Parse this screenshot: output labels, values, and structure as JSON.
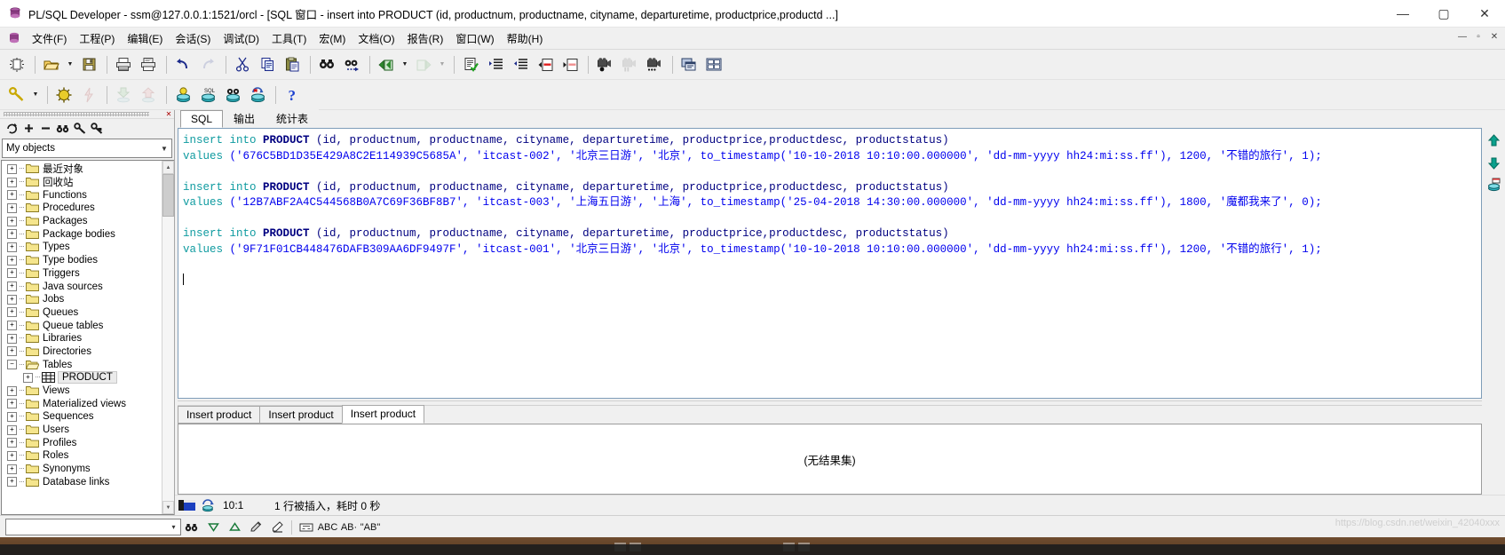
{
  "window": {
    "title": "PL/SQL Developer - ssm@127.0.0.1:1521/orcl - [SQL 窗口 - insert into PRODUCT (id, productnum, productname, cityname, departuretime, productprice,productd ...]",
    "app_icon": "plsql-developer-icon",
    "minimize": "—",
    "maximize": "▢",
    "close": "✕"
  },
  "menu": {
    "mdi_icon": "mdi-document-icon",
    "items": [
      {
        "label": "文件(F)",
        "name": "menu-file"
      },
      {
        "label": "工程(P)",
        "name": "menu-project"
      },
      {
        "label": "编辑(E)",
        "name": "menu-edit"
      },
      {
        "label": "会话(S)",
        "name": "menu-session"
      },
      {
        "label": "调试(D)",
        "name": "menu-debug"
      },
      {
        "label": "工具(T)",
        "name": "menu-tools"
      },
      {
        "label": "宏(M)",
        "name": "menu-macro"
      },
      {
        "label": "文档(O)",
        "name": "menu-document"
      },
      {
        "label": "报告(R)",
        "name": "menu-report"
      },
      {
        "label": "窗口(W)",
        "name": "menu-window"
      },
      {
        "label": "帮助(H)",
        "name": "menu-help"
      }
    ],
    "mdi_buttons": [
      "—",
      "▫",
      "✕"
    ]
  },
  "toolbar_row1": [
    {
      "name": "new-window-icon",
      "kind": "icon"
    },
    {
      "name": "toolbar-separator",
      "kind": "sep"
    },
    {
      "name": "open-file-icon",
      "kind": "icon"
    },
    {
      "name": "open-file-dropdown-icon",
      "kind": "arrow"
    },
    {
      "name": "save-icon",
      "kind": "icon"
    },
    {
      "name": "toolbar-separator",
      "kind": "sep"
    },
    {
      "name": "print-icon",
      "kind": "icon"
    },
    {
      "name": "print-preview-icon",
      "kind": "icon"
    },
    {
      "name": "toolbar-separator",
      "kind": "sep"
    },
    {
      "name": "undo-icon",
      "kind": "icon"
    },
    {
      "name": "redo-icon",
      "kind": "icon"
    },
    {
      "name": "toolbar-separator",
      "kind": "sep"
    },
    {
      "name": "cut-icon",
      "kind": "icon"
    },
    {
      "name": "copy-icon",
      "kind": "icon"
    },
    {
      "name": "paste-icon",
      "kind": "icon"
    },
    {
      "name": "toolbar-separator",
      "kind": "sep"
    },
    {
      "name": "find-icon",
      "kind": "icon"
    },
    {
      "name": "find-next-icon",
      "kind": "icon"
    },
    {
      "name": "toolbar-separator",
      "kind": "sep"
    },
    {
      "name": "previous-window-icon",
      "kind": "icon"
    },
    {
      "name": "previous-window-dropdown-icon",
      "kind": "arrow"
    },
    {
      "name": "next-window-icon",
      "kind": "icon"
    },
    {
      "name": "next-window-dropdown-icon",
      "kind": "arrow"
    },
    {
      "name": "toolbar-separator",
      "kind": "sep"
    },
    {
      "name": "check-syntax-icon",
      "kind": "icon"
    },
    {
      "name": "indent-icon",
      "kind": "icon"
    },
    {
      "name": "outdent-icon",
      "kind": "icon"
    },
    {
      "name": "comment-icon",
      "kind": "icon"
    },
    {
      "name": "uncomment-icon",
      "kind": "icon"
    },
    {
      "name": "toolbar-separator",
      "kind": "sep"
    },
    {
      "name": "record-macro-icon",
      "kind": "icon"
    },
    {
      "name": "pause-macro-icon",
      "kind": "icon"
    },
    {
      "name": "play-macro-icon",
      "kind": "icon"
    },
    {
      "name": "toolbar-separator",
      "kind": "sep"
    },
    {
      "name": "window-list-icon",
      "kind": "icon"
    },
    {
      "name": "tile-windows-icon",
      "kind": "icon"
    }
  ],
  "toolbar_row2": [
    {
      "name": "logon-key-icon",
      "kind": "icon"
    },
    {
      "name": "logon-dropdown-icon",
      "kind": "arrow"
    },
    {
      "name": "toolbar-separator",
      "kind": "sep"
    },
    {
      "name": "execute-icon",
      "kind": "icon"
    },
    {
      "name": "break-icon",
      "kind": "icon"
    },
    {
      "name": "toolbar-separator",
      "kind": "sep"
    },
    {
      "name": "import-icon",
      "kind": "icon"
    },
    {
      "name": "export-icon",
      "kind": "icon"
    },
    {
      "name": "toolbar-separator",
      "kind": "sep"
    },
    {
      "name": "commit-icon",
      "kind": "icon"
    },
    {
      "name": "sql-window-icon",
      "kind": "icon"
    },
    {
      "name": "explain-plan-icon",
      "kind": "icon"
    },
    {
      "name": "rollback-icon",
      "kind": "icon"
    },
    {
      "name": "toolbar-separator",
      "kind": "sep"
    },
    {
      "name": "help-icon",
      "kind": "icon"
    }
  ],
  "browser": {
    "grip_name": "panel-grip",
    "close_label": "✕",
    "tools": [
      {
        "name": "refresh-icon"
      },
      {
        "name": "expand-all-icon"
      },
      {
        "name": "collapse-all-icon"
      },
      {
        "name": "find-object-icon"
      },
      {
        "name": "filter-icon"
      },
      {
        "name": "lock-icon"
      }
    ],
    "filter_value": "My objects",
    "tree": [
      {
        "label": "最近对象",
        "level": 1,
        "expander": "+",
        "icon": "folder-icon",
        "selected": false
      },
      {
        "label": "回收站",
        "level": 1,
        "expander": "+",
        "icon": "folder-icon",
        "selected": false
      },
      {
        "label": "Functions",
        "level": 1,
        "expander": "+",
        "icon": "folder-icon",
        "selected": false
      },
      {
        "label": "Procedures",
        "level": 1,
        "expander": "+",
        "icon": "folder-icon",
        "selected": false
      },
      {
        "label": "Packages",
        "level": 1,
        "expander": "+",
        "icon": "folder-icon",
        "selected": false
      },
      {
        "label": "Package bodies",
        "level": 1,
        "expander": "+",
        "icon": "folder-icon",
        "selected": false
      },
      {
        "label": "Types",
        "level": 1,
        "expander": "+",
        "icon": "folder-icon",
        "selected": false
      },
      {
        "label": "Type bodies",
        "level": 1,
        "expander": "+",
        "icon": "folder-icon",
        "selected": false
      },
      {
        "label": "Triggers",
        "level": 1,
        "expander": "+",
        "icon": "folder-icon",
        "selected": false
      },
      {
        "label": "Java sources",
        "level": 1,
        "expander": "+",
        "icon": "folder-icon",
        "selected": false
      },
      {
        "label": "Jobs",
        "level": 1,
        "expander": "+",
        "icon": "folder-icon",
        "selected": false
      },
      {
        "label": "Queues",
        "level": 1,
        "expander": "+",
        "icon": "folder-icon",
        "selected": false
      },
      {
        "label": "Queue tables",
        "level": 1,
        "expander": "+",
        "icon": "folder-icon",
        "selected": false
      },
      {
        "label": "Libraries",
        "level": 1,
        "expander": "+",
        "icon": "folder-icon",
        "selected": false
      },
      {
        "label": "Directories",
        "level": 1,
        "expander": "+",
        "icon": "folder-icon",
        "selected": false
      },
      {
        "label": "Tables",
        "level": 1,
        "expander": "−",
        "icon": "folder-open-icon",
        "selected": false
      },
      {
        "label": "PRODUCT",
        "level": 2,
        "expander": "+",
        "icon": "table-icon",
        "selected": true
      },
      {
        "label": "Views",
        "level": 1,
        "expander": "+",
        "icon": "folder-icon",
        "selected": false
      },
      {
        "label": "Materialized views",
        "level": 1,
        "expander": "+",
        "icon": "folder-icon",
        "selected": false
      },
      {
        "label": "Sequences",
        "level": 1,
        "expander": "+",
        "icon": "folder-icon",
        "selected": false
      },
      {
        "label": "Users",
        "level": 1,
        "expander": "+",
        "icon": "folder-icon",
        "selected": false
      },
      {
        "label": "Profiles",
        "level": 1,
        "expander": "+",
        "icon": "folder-icon",
        "selected": false
      },
      {
        "label": "Roles",
        "level": 1,
        "expander": "+",
        "icon": "folder-icon",
        "selected": false
      },
      {
        "label": "Synonyms",
        "level": 1,
        "expander": "+",
        "icon": "folder-icon",
        "selected": false
      },
      {
        "label": "Database links",
        "level": 1,
        "expander": "+",
        "icon": "folder-icon",
        "selected": false
      }
    ]
  },
  "document": {
    "tabs": [
      {
        "label": "SQL",
        "active": true,
        "name": "tab-sql"
      },
      {
        "label": "输出",
        "active": false,
        "name": "tab-output"
      },
      {
        "label": "统计表",
        "active": false,
        "name": "tab-statistics"
      }
    ]
  },
  "editor": {
    "statements": [
      {
        "line1_kw": "insert into",
        "line1_obj": " PRODUCT ",
        "line1_cols": "(id, productnum, productname, cityname, departuretime, productprice,productdesc, productstatus)",
        "line2_kw": "values",
        "line2_rest": " ('676C5BD1D35E429A8C2E114939C5685A', 'itcast-002', '北京三日游', '北京', to_timestamp('10-10-2018 10:10:00.000000', 'dd-mm-yyyy hh24:mi:ss.ff'), 1200, '不错的旅行', 1);"
      },
      {
        "line1_kw": "insert into",
        "line1_obj": " PRODUCT ",
        "line1_cols": "(id, productnum, productname, cityname, departuretime, productprice,productdesc, productstatus)",
        "line2_kw": "values",
        "line2_rest": " ('12B7ABF2A4C544568B0A7C69F36BF8B7', 'itcast-003', '上海五日游', '上海', to_timestamp('25-04-2018 14:30:00.000000', 'dd-mm-yyyy hh24:mi:ss.ff'), 1800, '魔都我来了', 0);"
      },
      {
        "line1_kw": "insert into",
        "line1_obj": " PRODUCT ",
        "line1_cols": "(id, productnum, productname, cityname, departuretime, productprice,productdesc, productstatus)",
        "line2_kw": "values",
        "line2_rest": " ('9F71F01CB448476DAFB309AA6DF9497F', 'itcast-001', '北京三日游', '北京', to_timestamp('10-10-2018 10:10:00.000000', 'dd-mm-yyyy hh24:mi:ss.ff'), 1200, '不错的旅行', 1);"
      }
    ],
    "rail": [
      {
        "name": "scroll-up-icon"
      },
      {
        "name": "scroll-down-icon"
      },
      {
        "name": "query-builder-icon"
      }
    ]
  },
  "results": {
    "tabs": [
      {
        "label": "Insert product",
        "active": false,
        "name": "result-tab-1"
      },
      {
        "label": "Insert product",
        "active": false,
        "name": "result-tab-2"
      },
      {
        "label": "Insert product",
        "active": true,
        "name": "result-tab-3"
      }
    ],
    "empty_message": "(无结果集)"
  },
  "status": {
    "flag_icon": "national-flag-icon",
    "connection_icon": "connection-status-icon",
    "position": "10:1",
    "message": "1 行被插入，耗时 0 秒"
  },
  "bottom": {
    "input_value": "",
    "input_chevron": "▾",
    "icons": [
      {
        "name": "find-binoculars-icon"
      },
      {
        "name": "find-down-icon"
      },
      {
        "name": "find-up-icon"
      },
      {
        "name": "highlight-all-icon"
      },
      {
        "name": "clear-highlight-icon"
      },
      {
        "name": "match-whole-word-icon"
      },
      {
        "name": "match-case-abc-icon",
        "label": "ABC"
      },
      {
        "name": "regex-icon",
        "label": "AB·"
      },
      {
        "name": "match-case-quoted-icon",
        "label": "\"AB\""
      }
    ]
  },
  "watermark": "https://blog.csdn.net/weixin_42040xxx",
  "colors": {
    "keyword": "#0f9ba0",
    "identifier": "#000080",
    "literal": "#0000ee",
    "chrome": "#f0f0f0",
    "selection": "#ebebeb"
  }
}
